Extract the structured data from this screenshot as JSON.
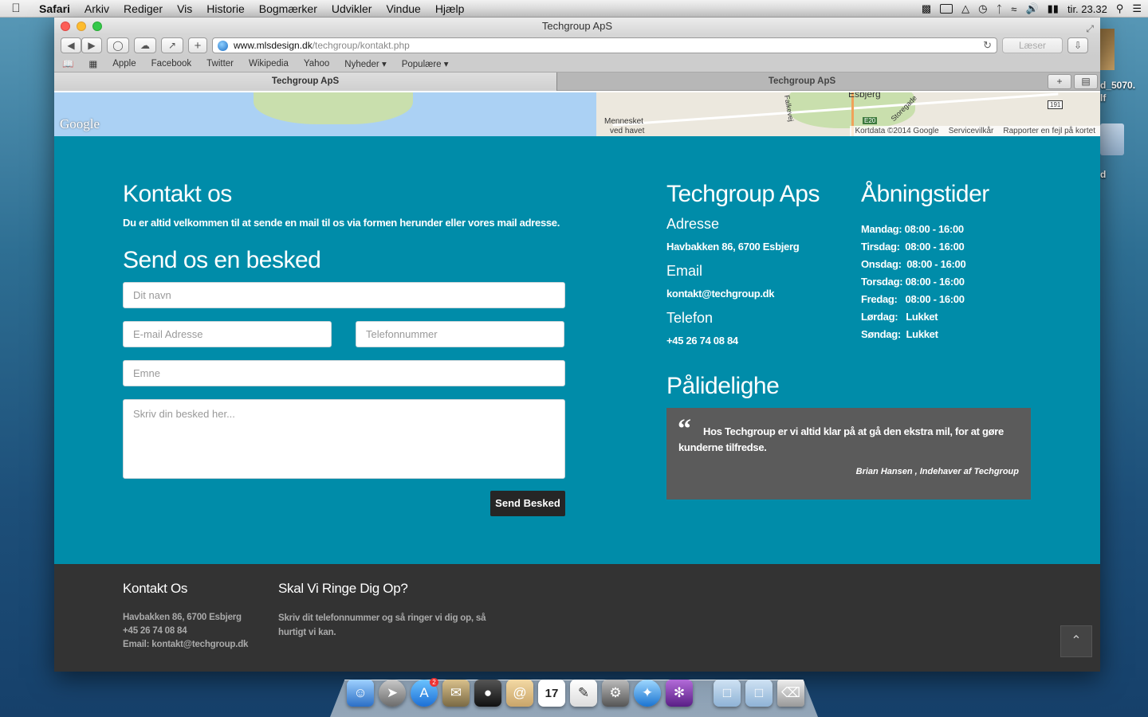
{
  "menubar": {
    "app": "Safari",
    "items": [
      "Arkiv",
      "Rediger",
      "Vis",
      "Historie",
      "Bogmærker",
      "Udvikler",
      "Vindue",
      "Hjælp"
    ],
    "clock": "tir. 23.32"
  },
  "desktop": {
    "label1": "d_5070.",
    "label2": "lf",
    "label3": "d"
  },
  "window": {
    "title": "Techgroup ApS"
  },
  "toolbar": {
    "url_host": "www.mlsdesign.dk",
    "url_path": "/techgroup/kontakt.php",
    "reader_label": "Læser"
  },
  "bookmarks": [
    "Apple",
    "Facebook",
    "Twitter",
    "Wikipedia",
    "Yahoo",
    "Nyheder ▾",
    "Populære ▾"
  ],
  "tabs": [
    {
      "label": "Techgroup ApS"
    },
    {
      "label": "Techgroup ApS"
    }
  ],
  "map": {
    "place_label": "Esbjerg",
    "memo_label1": "Mennesket",
    "memo_label2": "ved havet",
    "road_badge": "E20",
    "road_num": "191",
    "street1": "Falkevej",
    "street2": "Storegade",
    "attrib_data": "Kortdata ©2014 Google",
    "attrib_terms": "Servicevilkår",
    "attrib_report": "Rapporter en fejl på kortet",
    "google_logo": "Google"
  },
  "contact": {
    "title": "Kontakt os",
    "intro": "Du er altid velkommen til at sende en mail til os via formen herunder eller vores mail adresse.",
    "form_title": "Send os en besked",
    "name_placeholder": "Dit navn",
    "email_placeholder": "E-mail Adresse",
    "phone_placeholder": "Telefonnummer",
    "subject_placeholder": "Emne",
    "message_placeholder": "Skriv din besked her...",
    "send_label": "Send Besked"
  },
  "company": {
    "title": "Techgroup Aps",
    "address_label": "Adresse",
    "address": "Havbakken 86, 6700 Esbjerg",
    "email_label": "Email",
    "email": "kontakt@techgroup.dk",
    "phone_label": "Telefon",
    "phone": "+45 26 74 08 84"
  },
  "hours": {
    "title": "Åbningstider",
    "rows": [
      {
        "day": "Mandag:",
        "time": "08:00 - 16:00"
      },
      {
        "day": "Tirsdag:",
        "time": "08:00 - 16:00"
      },
      {
        "day": "Onsdag:",
        "time": "08:00 - 16:00"
      },
      {
        "day": "Torsdag:",
        "time": "08:00 - 16:00"
      },
      {
        "day": "Fredag:",
        "time": "08:00 - 16:00"
      },
      {
        "day": "Lørdag:",
        "time": "Lukket"
      },
      {
        "day": "Søndag:",
        "time": "Lukket"
      }
    ]
  },
  "reliability": {
    "title": "Pålidelighe",
    "quote": "Hos Techgroup er vi altid klar på at gå den ekstra mil, for at gøre kunderne tilfredse.",
    "author": "Brian Hansen , Indehaver af Techgroup"
  },
  "footer": {
    "col1_title": "Kontakt Os",
    "col1_line1": "Havbakken 86, 6700 Esbjerg",
    "col1_line2": "+45 26 74 08 84",
    "col1_line3": "Email: kontakt@techgroup.dk",
    "col2_title": "Skal Vi Ringe Dig Op?",
    "col2_line1": "Skriv dit telefonnummer og så ringer vi dig op, så",
    "col2_line2": "hurtigt vi kan.",
    "to_top_icon": "chevron-up-icon"
  },
  "dock": {
    "calendar_day": "17",
    "appstore_badge": "2"
  }
}
